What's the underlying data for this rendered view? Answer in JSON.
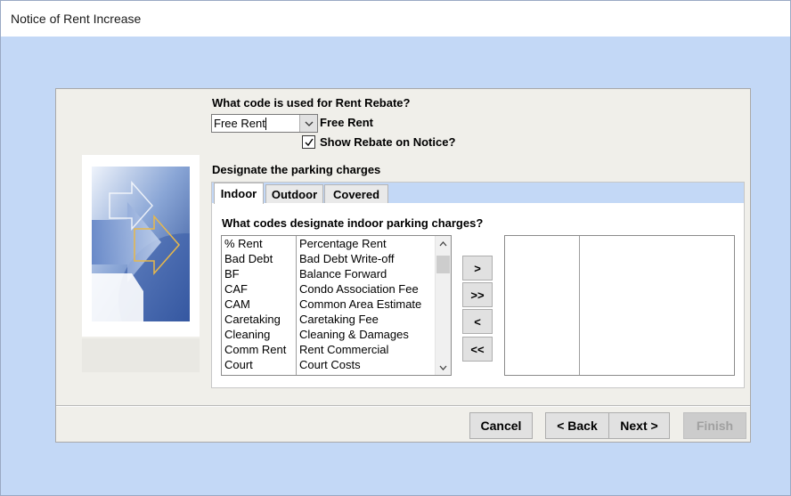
{
  "window": {
    "title": "Notice of Rent Increase"
  },
  "rebate": {
    "question": "What code is used for Rent Rebate?",
    "selected_code": "Free Rent",
    "description": "Free Rent",
    "show_on_notice_label": "Show Rebate on Notice?",
    "show_on_notice_checked": true
  },
  "parking": {
    "heading": "Designate the parking charges",
    "tabs": [
      {
        "label": "Indoor",
        "active": true
      },
      {
        "label": "Outdoor",
        "active": false
      },
      {
        "label": "Covered",
        "active": false
      }
    ],
    "prompt": "What codes designate indoor parking charges?",
    "available_codes": [
      {
        "code": "% Rent",
        "description": "Percentage Rent"
      },
      {
        "code": "Bad Debt",
        "description": "Bad Debt Write-off"
      },
      {
        "code": "BF",
        "description": "Balance Forward"
      },
      {
        "code": "CAF",
        "description": "Condo Association Fee"
      },
      {
        "code": "CAM",
        "description": "Common Area Estimate"
      },
      {
        "code": "Caretaking",
        "description": "Caretaking Fee"
      },
      {
        "code": "Cleaning",
        "description": "Cleaning & Damages"
      },
      {
        "code": "Comm Rent",
        "description": "Rent Commercial"
      },
      {
        "code": "Court",
        "description": "Court Costs"
      }
    ],
    "selected_codes": [],
    "move_buttons": {
      "add_one": ">",
      "add_all": ">>",
      "remove_one": "<",
      "remove_all": "<<"
    }
  },
  "wizard_buttons": {
    "cancel": "Cancel",
    "back": "< Back",
    "next": "Next >",
    "finish": "Finish",
    "finish_enabled": false
  },
  "colors": {
    "desktop_blue": "#c3d8f6",
    "dialog_bg": "#f0efea",
    "button_face": "#e1e1e1"
  }
}
